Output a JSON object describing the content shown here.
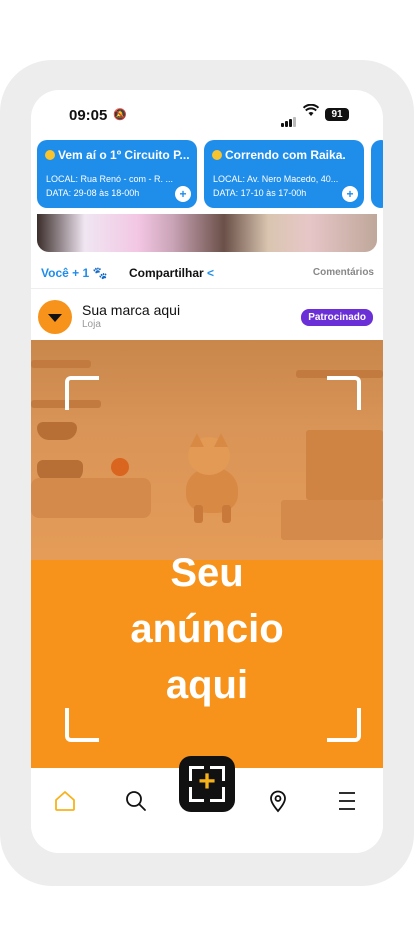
{
  "status": {
    "time": "09:05",
    "battery": "91"
  },
  "events": [
    {
      "title": "Vem aí o 1º Circuito P...",
      "local": "LOCAL: Rua Renó - com - R. ...",
      "date": "DATA: 29-08 às 18-00h"
    },
    {
      "title": "Correndo com Raika.",
      "local": "LOCAL: Av. Nero Macedo, 40...",
      "date": "DATA: 17-10 às 17-00h"
    }
  ],
  "actions": {
    "you": "Você + 1",
    "share": "Compartilhar",
    "comments": "Comentários"
  },
  "post": {
    "brand": "Sua marca aqui",
    "category": "Loja",
    "badge": "Patrocinado"
  },
  "ad": {
    "line1": "Seu",
    "line2": "anúncio",
    "line3": "aqui"
  },
  "colors": {
    "accent": "#1f8dea",
    "brand_orange": "#f7931a",
    "badge_purple": "#6a2fd6"
  }
}
